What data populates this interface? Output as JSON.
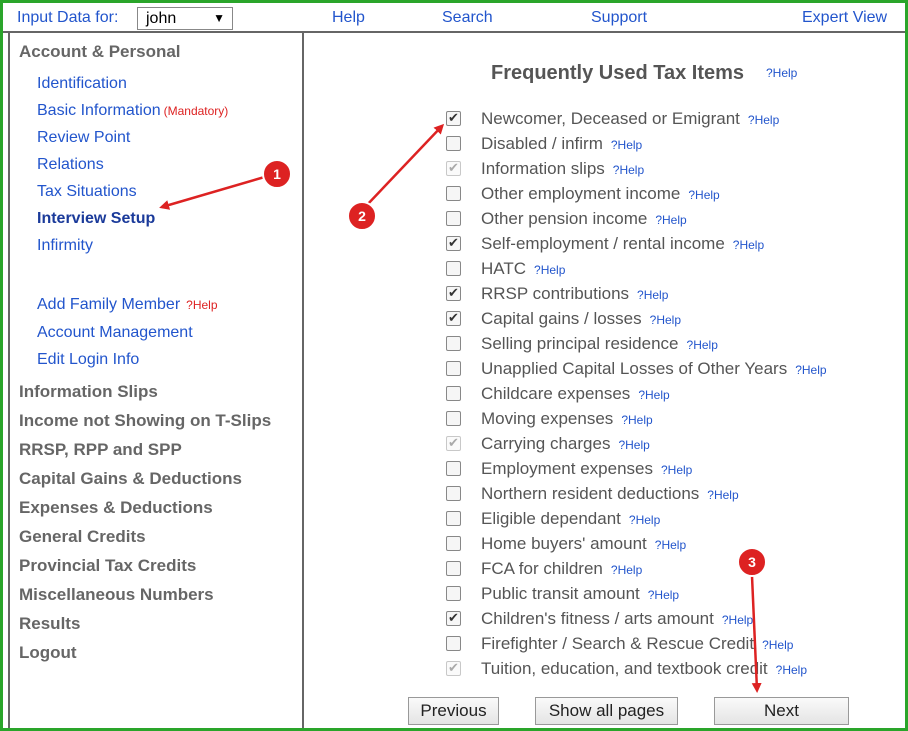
{
  "topbar": {
    "input_label": "Input Data for:",
    "user": "john",
    "links": [
      "Help",
      "Search",
      "Support",
      "Expert View"
    ]
  },
  "sidebar": {
    "section_title": "Account & Personal",
    "items": [
      {
        "label": "Identification"
      },
      {
        "label": "Basic Information",
        "badge": "(Mandatory)"
      },
      {
        "label": "Review Point"
      },
      {
        "label": "Relations"
      },
      {
        "label": "Tax Situations"
      },
      {
        "label": "Interview Setup",
        "active": true
      },
      {
        "label": "Infirmity"
      }
    ],
    "extra_items": [
      {
        "label": "Add Family Member",
        "help": "?Help"
      },
      {
        "label": "Account Management"
      },
      {
        "label": "Edit Login Info"
      }
    ],
    "sections": [
      "Information Slips",
      "Income not Showing on T-Slips",
      "RRSP, RPP and SPP",
      "Capital Gains & Deductions",
      "Expenses & Deductions",
      "General Credits",
      "Provincial Tax Credits",
      "Miscellaneous Numbers",
      "Results",
      "Logout"
    ]
  },
  "main": {
    "title": "Frequently Used Tax Items",
    "title_help": "?Help",
    "items": [
      {
        "label": "Newcomer, Deceased or Emigrant",
        "checked": true,
        "disabled": false,
        "help": "?Help"
      },
      {
        "label": "Disabled / infirm",
        "checked": false,
        "disabled": false,
        "help": "?Help"
      },
      {
        "label": "Information slips",
        "checked": true,
        "disabled": true,
        "help": "?Help"
      },
      {
        "label": "Other employment income",
        "checked": false,
        "disabled": false,
        "help": "?Help"
      },
      {
        "label": "Other pension income",
        "checked": false,
        "disabled": false,
        "help": "?Help"
      },
      {
        "label": "Self-employment / rental income",
        "checked": true,
        "disabled": false,
        "help": "?Help"
      },
      {
        "label": "HATC",
        "checked": false,
        "disabled": false,
        "help": "?Help"
      },
      {
        "label": "RRSP contributions",
        "checked": true,
        "disabled": false,
        "help": "?Help"
      },
      {
        "label": "Capital gains / losses",
        "checked": true,
        "disabled": false,
        "help": "?Help"
      },
      {
        "label": "Selling principal residence",
        "checked": false,
        "disabled": false,
        "help": "?Help"
      },
      {
        "label": "Unapplied Capital Losses of Other Years",
        "checked": false,
        "disabled": false,
        "help": "?Help"
      },
      {
        "label": "Childcare expenses",
        "checked": false,
        "disabled": false,
        "help": "?Help"
      },
      {
        "label": "Moving expenses",
        "checked": false,
        "disabled": false,
        "help": "?Help"
      },
      {
        "label": "Carrying charges",
        "checked": true,
        "disabled": true,
        "help": "?Help"
      },
      {
        "label": "Employment expenses",
        "checked": false,
        "disabled": false,
        "help": "?Help"
      },
      {
        "label": "Northern resident deductions",
        "checked": false,
        "disabled": false,
        "help": "?Help"
      },
      {
        "label": "Eligible dependant",
        "checked": false,
        "disabled": false,
        "help": "?Help"
      },
      {
        "label": "Home buyers' amount",
        "checked": false,
        "disabled": false,
        "help": "?Help"
      },
      {
        "label": "FCA for children",
        "checked": false,
        "disabled": false,
        "help": "?Help"
      },
      {
        "label": "Public transit amount",
        "checked": false,
        "disabled": false,
        "help": "?Help"
      },
      {
        "label": "Children's fitness / arts amount",
        "checked": true,
        "disabled": false,
        "help": "?Help"
      },
      {
        "label": "Firefighter / Search & Rescue Credit",
        "checked": false,
        "disabled": false,
        "help": "?Help"
      },
      {
        "label": "Tuition, education, and textbook credit",
        "checked": true,
        "disabled": true,
        "help": "?Help"
      }
    ],
    "buttons": {
      "previous": "Previous",
      "show_all": "Show all pages",
      "next": "Next"
    }
  },
  "annotations": {
    "markers": [
      "1",
      "2",
      "3"
    ]
  },
  "colors": {
    "frame": "#2aa52a",
    "link": "#2255cc",
    "marker": "#dd2222"
  }
}
